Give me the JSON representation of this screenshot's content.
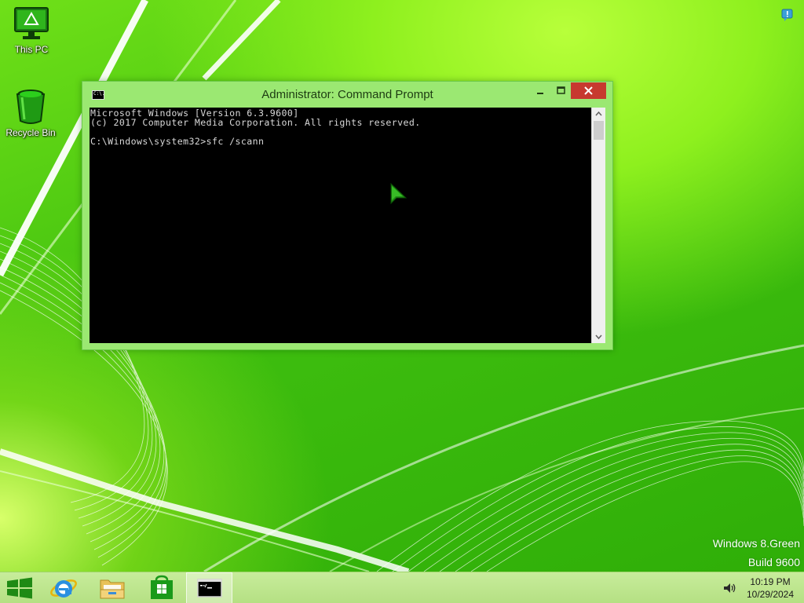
{
  "desktop": {
    "icons": [
      {
        "label": "This PC",
        "icon": "this-pc-icon"
      },
      {
        "label": "Recycle Bin",
        "icon": "recycle-bin-icon"
      }
    ],
    "watermark": {
      "edition": "Windows 8.Green",
      "build": "Build 9600"
    }
  },
  "window": {
    "title": "Administrator: Command Prompt",
    "icon_text": "C:\\.",
    "controls": [
      "minimize",
      "maximize",
      "close"
    ],
    "console_lines": [
      "Microsoft Windows [Version 6.3.9600]",
      "(c) 2017 Computer Media Corporation. All rights reserved.",
      "",
      "C:\\Windows\\system32>sfc /scann"
    ]
  },
  "taskbar": {
    "buttons": [
      {
        "name": "start",
        "icon": "windows-logo-icon"
      },
      {
        "name": "internet-explorer",
        "icon": "internet-explorer-icon"
      },
      {
        "name": "file-explorer",
        "icon": "file-explorer-icon"
      },
      {
        "name": "store",
        "icon": "store-icon"
      },
      {
        "name": "command-prompt",
        "icon": "command-prompt-icon",
        "active": true
      }
    ],
    "clock": {
      "time": "10:19 PM",
      "date": "10/29/2024"
    }
  },
  "colors": {
    "accent": "#9be872",
    "close_button": "#c7392f",
    "console_bg": "#000000",
    "console_text": "#d8d8d8",
    "taskbar": "#c7ec9b"
  }
}
